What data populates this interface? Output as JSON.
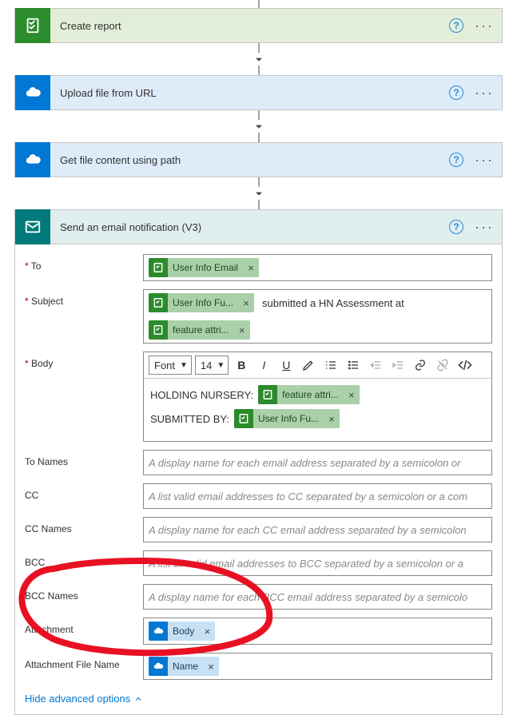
{
  "cards": {
    "report": "Create report",
    "upload": "Upload file from URL",
    "getfile": "Get file content using path",
    "email": "Send an email notification (V3)"
  },
  "email": {
    "labels": {
      "to": "To",
      "subject": "Subject",
      "body": "Body",
      "tonames": "To Names",
      "cc": "CC",
      "ccnames": "CC Names",
      "bcc": "BCC",
      "bccnames": "BCC Names",
      "attachment": "Attachment",
      "attachfile": "Attachment File Name"
    },
    "to_token": "User Info Email",
    "subject_token1": "User Info Fu...",
    "subject_text": "submitted a HN Assessment at",
    "subject_token2": "feature attri...",
    "body_label_holding": "HOLDING NURSERY:",
    "body_token_holding": "feature attri...",
    "body_label_submitted": "SUBMITTED BY:",
    "body_token_submitted": "User Info Fu...",
    "placeholders": {
      "tonames": "A display name for each email address separated by a semicolon or",
      "cc": "A list valid email addresses to CC separated by a semicolon or a com",
      "ccnames": "A display name for each CC email address separated by a semicolon",
      "bcc": "A list of valid email addresses to BCC separated by a semicolon or a",
      "bccnames": "A display name for each BCC email address separated by a semicolo"
    },
    "attachment_token": "Body",
    "attachfile_token": "Name",
    "toolbar": {
      "font": "Font",
      "size": "14"
    },
    "advanced": "Hide advanced options"
  }
}
